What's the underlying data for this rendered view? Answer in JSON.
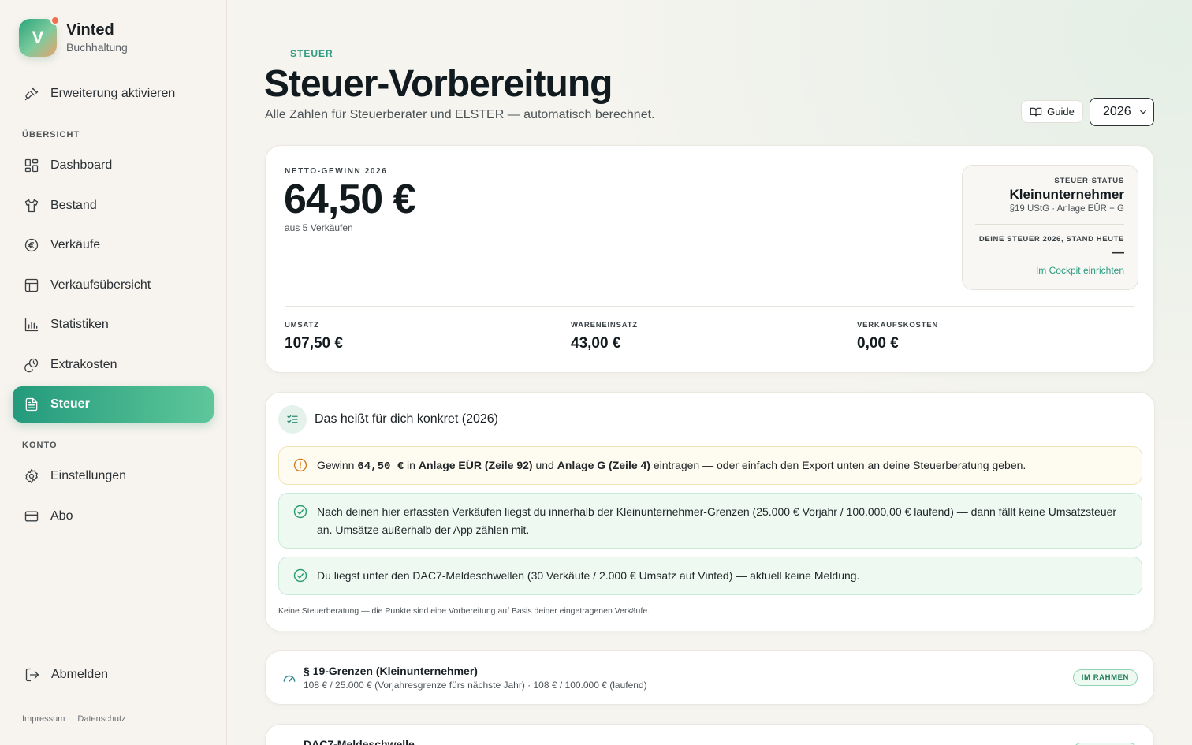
{
  "brand": {
    "logo_letter": "V",
    "name": "Vinted",
    "subtitle": "Buchhaltung"
  },
  "sidebar": {
    "extension": {
      "label": "Erweiterung aktivieren",
      "icon": "plug-icon"
    },
    "section_overview": "ÜBERSICHT",
    "items": [
      {
        "label": "Dashboard",
        "icon": "grid-icon"
      },
      {
        "label": "Bestand",
        "icon": "shirt-icon"
      },
      {
        "label": "Verkäufe",
        "icon": "euro-icon"
      },
      {
        "label": "Verkaufsübersicht",
        "icon": "table-icon"
      },
      {
        "label": "Statistiken",
        "icon": "bar-chart-icon"
      },
      {
        "label": "Extrakosten",
        "icon": "coins-icon"
      },
      {
        "label": "Steuer",
        "icon": "document-icon",
        "active": true
      }
    ],
    "section_account": "KONTO",
    "account_items": [
      {
        "label": "Einstellungen",
        "icon": "gear-icon"
      },
      {
        "label": "Abo",
        "icon": "credit-card-icon"
      }
    ],
    "logout": {
      "label": "Abmelden",
      "icon": "logout-icon"
    },
    "footer": {
      "imprint": "Impressum",
      "privacy": "Datenschutz"
    }
  },
  "header": {
    "kicker": "STEUER",
    "title": "Steuer-Vorbereitung",
    "subtitle": "Alle Zahlen für Steuerberater und ELSTER — automatisch berechnet.",
    "guide_label": "Guide",
    "year": "2026"
  },
  "summary": {
    "label": "NETTO-GEWINN 2026",
    "value": "64,50 €",
    "sub": "aus 5 Verkäufen",
    "status": {
      "label": "STEUER-STATUS",
      "value": "Kleinunternehmer",
      "sub": "§19 UStG · Anlage EÜR + G",
      "tax_label": "DEINE STEUER 2026, STAND HEUTE",
      "tax_value": "—",
      "link": "Im Cockpit einrichten"
    },
    "metrics": [
      {
        "label": "UMSATZ",
        "value": "107,50 €"
      },
      {
        "label": "WARENEINSATZ",
        "value": "43,00 €"
      },
      {
        "label": "VERKAUFSKOSTEN",
        "value": "0,00 €"
      }
    ]
  },
  "concrete": {
    "title": "Das heißt für dich konkret (2026)",
    "warn": {
      "p1": "Gewinn ",
      "amount": "64,50 €",
      "p2": " in ",
      "b1": "Anlage EÜR (Zeile 92)",
      "p3": " und ",
      "b2": "Anlage G (Zeile 4)",
      "p4": " eintragen — oder einfach den Export unten an deine Steuerberatung geben."
    },
    "ok1": "Nach deinen hier erfassten Verkäufen liegst du innerhalb der Kleinunternehmer-Grenzen (25.000 € Vorjahr / 100.000,00 € laufend) — dann fällt keine Umsatzsteuer an. Umsätze außerhalb der App zählen mit.",
    "ok2": "Du liegst unter den DAC7-Meldeschwellen (30 Verkäufe / 2.000 € Umsatz auf Vinted) — aktuell keine Meldung.",
    "disclaimer": "Keine Steuerberatung — die Punkte sind eine Vorbereitung auf Basis deiner eingetragenen Verkäufe."
  },
  "limits": {
    "title": "§ 19-Grenzen (Kleinunternehmer)",
    "sub": "108 € / 25.000 € (Vorjahresgrenze fürs nächste Jahr) · 108 € / 100.000 € (laufend)",
    "badge": "IM RAHMEN"
  },
  "dac7": {
    "title": "DAC7-Meldeschwelle"
  }
}
